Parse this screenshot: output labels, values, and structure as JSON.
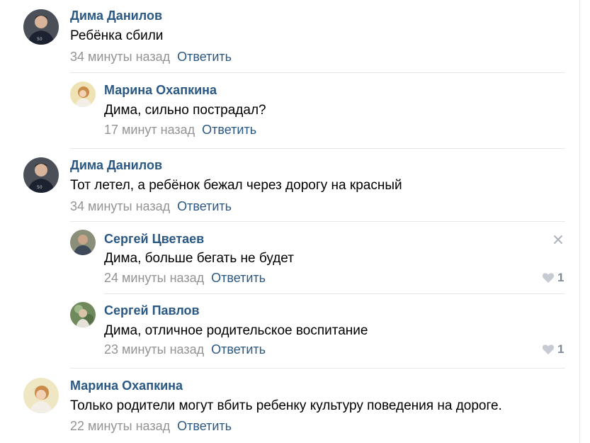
{
  "comments": [
    {
      "author": "Дима Данилов",
      "text": "Ребёнка сбили",
      "time": "34 минуты назад",
      "reply": "Ответить"
    },
    {
      "author": "Марина Охапкина",
      "text": "Дима, сильно пострадал?",
      "time": "17 минут назад",
      "reply": "Ответить"
    },
    {
      "author": "Дима Данилов",
      "text": "Тот летел, а ребёнок бежал через дорогу на красный",
      "time": "34 минуты назад",
      "reply": "Ответить"
    },
    {
      "author": "Сергей Цветаев",
      "text": "Дима, больше бегать не будет",
      "time": "24 минуты назад",
      "reply": "Ответить",
      "likes": "1"
    },
    {
      "author": "Сергей Павлов",
      "text": "Дима, отличное родительское воспитание",
      "time": "23 минуты назад",
      "reply": "Ответить",
      "likes": "1"
    },
    {
      "author": "Марина Охапкина",
      "text": "Только родители могут вбить ребенку культуру поведения на дороге.",
      "time": "22 минуты назад",
      "reply": "Ответить"
    }
  ],
  "icons": {
    "like": "heart-icon",
    "close": "close-icon"
  },
  "colors": {
    "link": "#2a5885",
    "meta": "#939393",
    "like": "#828a99"
  }
}
